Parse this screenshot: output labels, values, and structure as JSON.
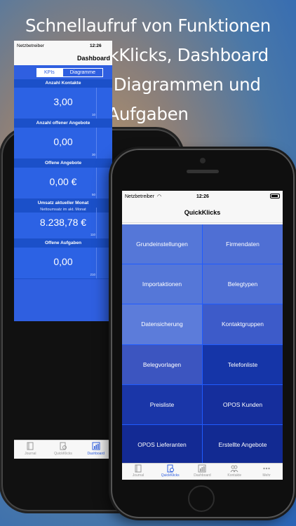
{
  "headline": {
    "line1": "Schnellaufruf von Funktionen",
    "line2": "über QuickKlicks, Dashboard",
    "line3": "mit KPIs, Diagrammen und",
    "line4": "Aufgaben"
  },
  "back_phone": {
    "status": {
      "carrier": "Netzbetreiber",
      "time": "12:26"
    },
    "nav_title": "Dashboard",
    "segments": {
      "kpis": "KPIs",
      "diagramme": "Diagramme"
    },
    "kpis": [
      {
        "title": "Anzahl Kontakte",
        "subtitle": "",
        "value": "3,00",
        "max": "10"
      },
      {
        "title": "Anzahl offener Angebote",
        "subtitle": "",
        "value": "0,00",
        "max": "30"
      },
      {
        "title": "Offene Angebote",
        "subtitle": "",
        "value": "0,00 €",
        "max": "50"
      },
      {
        "title": "Umsatz aktueller Monat",
        "subtitle": "Nettoumsatz im akt. Monat",
        "value": "8.238,78 €",
        "max": "110"
      },
      {
        "title": "Offene Aufgaben",
        "subtitle": "",
        "value": "0,00",
        "max": "210"
      }
    ],
    "tabs": {
      "journal": "Journal",
      "quickklicks": "QuickKlicks",
      "dashboard": "Dashboard"
    }
  },
  "front_phone": {
    "status": {
      "carrier": "Netzbetreiber",
      "time": "12:26"
    },
    "nav_title": "QuickKlicks",
    "tiles": [
      {
        "label": "Grundeinstellungen",
        "color": "#5577d8"
      },
      {
        "label": "Firmendaten",
        "color": "#4f6fd4"
      },
      {
        "label": "Importaktionen",
        "color": "#5577d8"
      },
      {
        "label": "Belegtypen",
        "color": "#4f6fd4"
      },
      {
        "label": "Datensicherung",
        "color": "#5c7cda"
      },
      {
        "label": "Kontaktgruppen",
        "color": "#3d5bc9"
      },
      {
        "label": "Belegvorlagen",
        "color": "#3c55c0"
      },
      {
        "label": "Telefonliste",
        "color": "#1535a8"
      },
      {
        "label": "Preisliste",
        "color": "#1a36a8"
      },
      {
        "label": "OPOS Kunden",
        "color": "#152e9c"
      },
      {
        "label": "OPOS Lieferanten",
        "color": "#132a94"
      },
      {
        "label": "Erstellte Angebote",
        "color": "#122a92"
      }
    ],
    "tabs": {
      "journal": "Journal",
      "quickklicks": "QuickKlicks",
      "dashboard": "Dashboard",
      "kontakte": "Kontakte",
      "mehr": "Mehr"
    },
    "accent": "#2f5fe0"
  }
}
